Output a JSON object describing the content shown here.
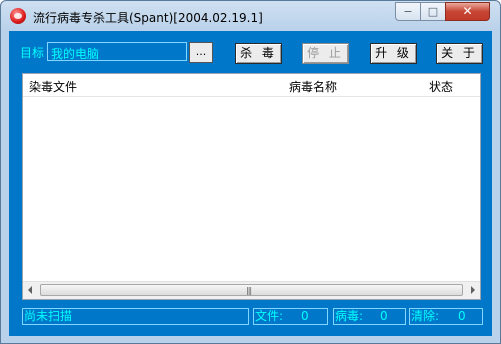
{
  "window": {
    "title": "流行病毒专杀工具(Spant)[2004.02.19.1]",
    "minimize_glyph": "−",
    "maximize_glyph": "□",
    "close_glyph": "✕"
  },
  "toolbar": {
    "target_label": "目标",
    "target_value": "我的电脑",
    "browse_label": "...",
    "kill_label": "杀 毒",
    "stop_label": "停 止",
    "upgrade_label": "升 级",
    "about_label": "关 于"
  },
  "table": {
    "columns": [
      "染毒文件",
      "病毒名称",
      "状态"
    ],
    "rows": []
  },
  "status": {
    "scan_state": "尚未扫描",
    "files_label": "文件:",
    "files_value": "0",
    "virus_label": "病毒:",
    "virus_value": "0",
    "cleared_label": "清除:",
    "cleared_value": "0"
  },
  "icons": {
    "app": "red-ball-icon",
    "scroll_left": "arrow-left-icon",
    "scroll_right": "arrow-right-icon",
    "scroll_grip": "grip-icon"
  },
  "colors": {
    "client_bg": "#0077c8",
    "accent_text": "#00ffff",
    "frame": "#b9d1ea"
  }
}
